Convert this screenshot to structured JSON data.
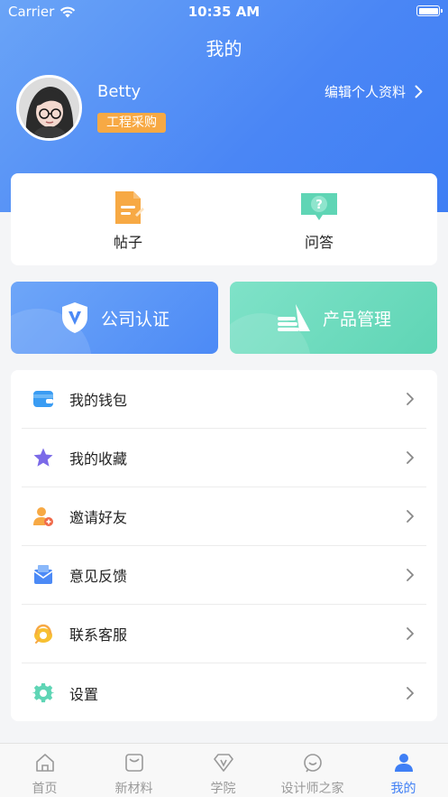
{
  "status_bar": {
    "carrier": "Carrier",
    "time": "10:35 AM"
  },
  "header": {
    "title": "我的"
  },
  "profile": {
    "name": "Betty",
    "tag": "工程采购",
    "edit_label": "编辑个人资料"
  },
  "quick_actions": [
    {
      "label": "帖子",
      "icon": "document-icon",
      "color": "#f7a944"
    },
    {
      "label": "问答",
      "icon": "question-bubble-icon",
      "color": "#5fd5b5"
    }
  ],
  "feature_buttons": {
    "company": {
      "label": "公司认证",
      "icon": "shield-v-icon"
    },
    "product": {
      "label": "产品管理",
      "icon": "layers-icon"
    }
  },
  "menu": [
    {
      "label": "我的钱包",
      "icon": "wallet-icon"
    },
    {
      "label": "我的收藏",
      "icon": "star-icon"
    },
    {
      "label": "邀请好友",
      "icon": "invite-user-icon"
    },
    {
      "label": "意见反馈",
      "icon": "feedback-mail-icon"
    },
    {
      "label": "联系客服",
      "icon": "headset-icon"
    },
    {
      "label": "设置",
      "icon": "gear-icon"
    }
  ],
  "tabbar": [
    {
      "label": "首页",
      "icon": "home-icon",
      "active": false
    },
    {
      "label": "新材料",
      "icon": "material-icon",
      "active": false
    },
    {
      "label": "学院",
      "icon": "academy-icon",
      "active": false
    },
    {
      "label": "设计师之家",
      "icon": "designer-icon",
      "active": false
    },
    {
      "label": "我的",
      "icon": "user-icon",
      "active": true
    }
  ],
  "colors": {
    "primary": "#4a86f5",
    "accent_orange": "#f7a944",
    "accent_teal": "#5fd5b5",
    "tab_active": "#3f7ff5",
    "tab_inactive": "#999999"
  }
}
